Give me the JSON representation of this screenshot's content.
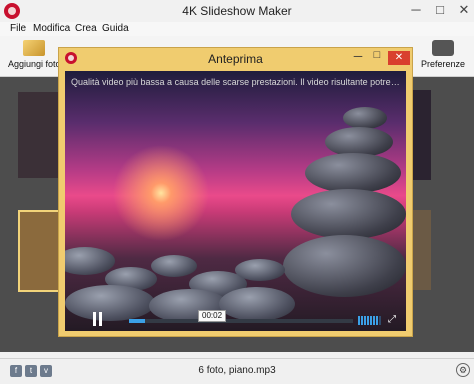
{
  "window": {
    "title": "4K Slideshow Maker",
    "controls": {
      "minimize": "─",
      "maximize": "□",
      "close": "✕"
    }
  },
  "menu": [
    "File",
    "Modifica",
    "Crea",
    "Guida"
  ],
  "toolbar": {
    "add_photos_label": "Aggiungi foto",
    "preferences_label": "Preferenze"
  },
  "status": {
    "summary": "6 foto, piano.mp3",
    "social": [
      "f",
      "t",
      "v"
    ]
  },
  "preview": {
    "title": "Anteprima",
    "controls": {
      "minimize": "─",
      "maximize": "□",
      "close": "✕"
    },
    "warning": "Qualità video più bassa a causa delle scarse prestazioni. Il video risultante potrebbe essere molt...",
    "time": "00:02",
    "progress_fraction": 0.07,
    "volume_level": 0.85
  },
  "colors": {
    "preview_border": "#f0cc6f",
    "accent_blue": "#3ba0e6",
    "close_red": "#d9402e"
  }
}
